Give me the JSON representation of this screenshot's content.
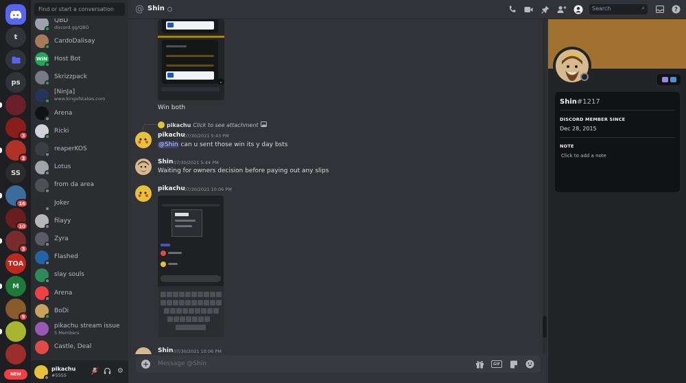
{
  "colors": {
    "accent": "#5865f2",
    "mention_badge": "#f23f43",
    "online": "#23a55a",
    "idle": "#f0b232",
    "dnd": "#f23f43",
    "offline": "#80848e",
    "banner": "#a0712f"
  },
  "servers": [
    {
      "label": "",
      "icon": "discord-icon",
      "type": "home"
    },
    {
      "label": "t"
    },
    {
      "label": "",
      "icon": "folder-icon"
    },
    {
      "label": "ps"
    },
    {
      "label": "",
      "color": "#6b1f2a"
    },
    {
      "label": "",
      "color": "#8b1c1c",
      "badge": "3"
    },
    {
      "label": "",
      "color": "#b03127",
      "badge": "3"
    },
    {
      "label": "SS",
      "color": "#2b2b2b"
    },
    {
      "label": "",
      "color": "#3a6c9c",
      "badge": "16"
    },
    {
      "label": "",
      "color": "#6a1d1d",
      "badge": "10"
    },
    {
      "label": "",
      "color": "#7a2b2b",
      "badge": "3"
    },
    {
      "label": "TOA",
      "color": "#c0281d"
    },
    {
      "label": "M",
      "color": "#1f7a3a"
    },
    {
      "label": "",
      "color": "#8a5a2a",
      "badge": "9"
    },
    {
      "label": "",
      "color": "#a7b530"
    },
    {
      "label": "",
      "color": "#9c2d2d"
    }
  ],
  "new_label": "NEW",
  "dm_search": {
    "placeholder": "Find or start a conversation"
  },
  "dm_list": [
    {
      "name": "QBD",
      "sub": "discord.gg/QBD",
      "color": "#9aa3ad",
      "status": "online"
    },
    {
      "name": "CardoDalisay",
      "sub": "",
      "color": "#a87a5c",
      "status": "online"
    },
    {
      "name": "Host Bot",
      "sub": "",
      "color": "#23a55a",
      "status": "online",
      "initials": "WiN"
    },
    {
      "name": "Skrizzpack",
      "sub": "",
      "color": "#777b85",
      "status": "online"
    },
    {
      "name": "[NinJa]",
      "sub": "www.kingofstakes.com",
      "color": "#26345a",
      "status": "online"
    },
    {
      "name": "Arena",
      "sub": "",
      "color": "#111214",
      "status": "offline"
    },
    {
      "name": "Ricki",
      "sub": "",
      "color": "#cfd4da",
      "status": "online"
    },
    {
      "name": "reaperKOS",
      "sub": "",
      "color": "#3b3e45",
      "status": "offline"
    },
    {
      "name": "Lotus",
      "sub": "",
      "color": "#a0a4aa",
      "status": "offline"
    },
    {
      "name": "from da area",
      "sub": "",
      "color": "#4e5058",
      "status": "offline"
    },
    {
      "name": "Joker",
      "sub": "",
      "color": "#2a2b30",
      "status": "offline"
    },
    {
      "name": "filayy",
      "sub": "",
      "color": "#b8b8b8",
      "status": "offline"
    },
    {
      "name": "Zyra",
      "sub": "",
      "color": "#595c64",
      "status": "offline"
    },
    {
      "name": "Flashed",
      "sub": "",
      "color": "#2563a8",
      "status": "offline"
    },
    {
      "name": "slay souls",
      "sub": "",
      "color": "#2f8a5a",
      "status": "offline"
    },
    {
      "name": "Arena",
      "sub": "",
      "color": "#ed4245",
      "status": "offline"
    },
    {
      "name": "BoDi",
      "sub": "",
      "color": "#c9a25d",
      "status": "online"
    },
    {
      "name": "pikachu stream issue",
      "sub": "5 Members",
      "color": "#9b59b6",
      "status": ""
    },
    {
      "name": "Castle, Deal",
      "sub": "",
      "color": "#e24a4a",
      "status": ""
    }
  ],
  "user": {
    "name": "pikachu",
    "tag": "#5555"
  },
  "header": {
    "channel": "Shin",
    "search_placeholder": "Search"
  },
  "messages": {
    "win_both": "Win both",
    "reply": {
      "name": "pikachu",
      "text": "Click to see attachment"
    },
    "m1": {
      "author": "pikachu",
      "time": "07/30/2021 5:43 PM",
      "mention": "@Shin",
      "text": " can u sent those win its y day bsts"
    },
    "m2": {
      "author": "Shin",
      "time": "07/30/2021 5:44 PM",
      "text": "Waiting for owners decision before paying out any slips"
    },
    "m3": {
      "author": "pikachu",
      "time": "07/30/2021 10:06 PM"
    },
    "m4": {
      "author": "Shin",
      "time": "07/30/2021 10:06 PM"
    }
  },
  "composer": {
    "placeholder": "Message @Shin",
    "gif_label": "GIF"
  },
  "profile": {
    "name": "Shin",
    "discriminator": "#1217",
    "member_since_heading": "DISCORD MEMBER SINCE",
    "member_since": "Dec 28, 2015",
    "note_heading": "NOTE",
    "note_placeholder": "Click to add a note"
  }
}
